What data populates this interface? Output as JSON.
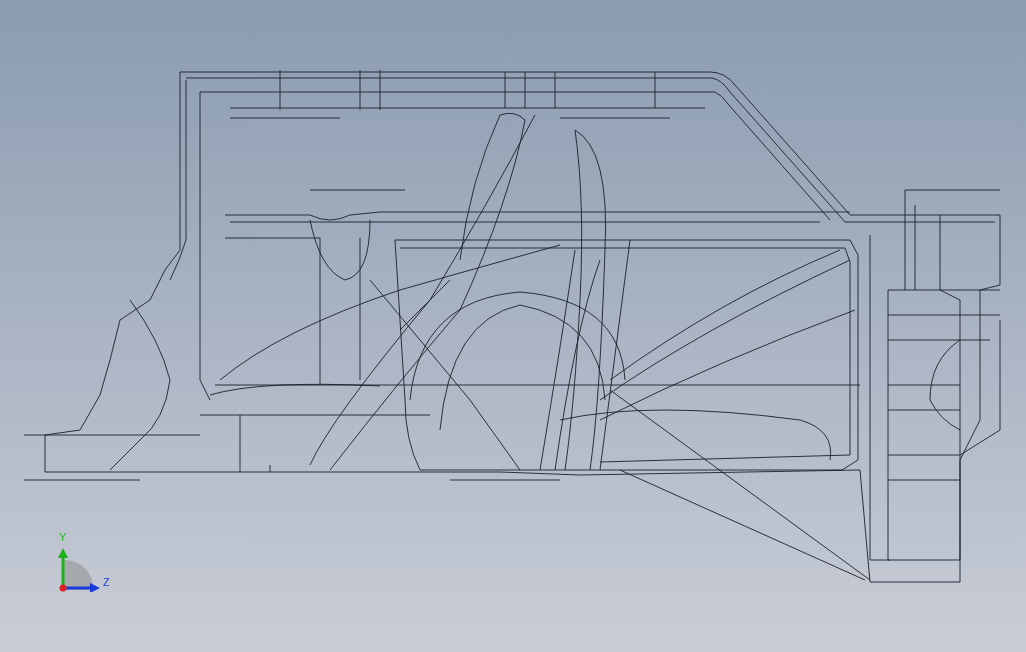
{
  "viewport": {
    "axis_triad": {
      "y_label": "Y",
      "z_label": "Z"
    }
  }
}
